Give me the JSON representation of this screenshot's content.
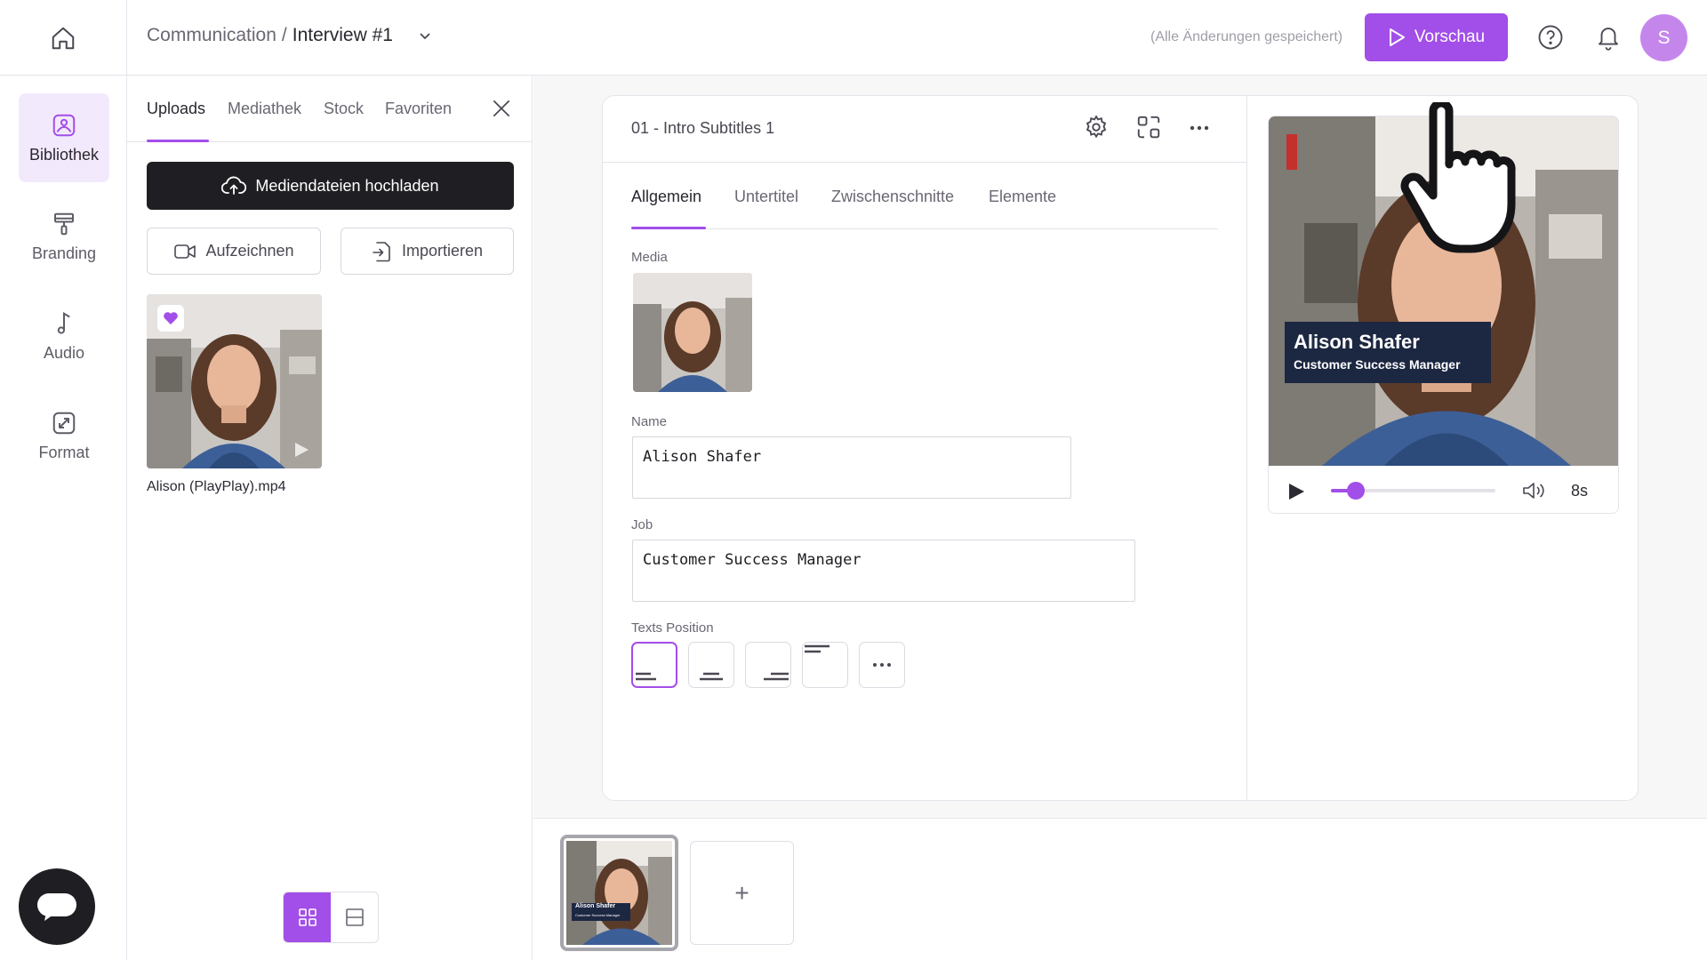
{
  "topbar": {
    "breadcrumb_parent": "Communication",
    "breadcrumb_sep": "/",
    "breadcrumb_current": "Interview #1",
    "saved_status": "(Alle Änderungen gespeichert)",
    "preview_label": "Vorschau",
    "avatar_initial": "S"
  },
  "leftnav": {
    "items": [
      {
        "label": "Bibliothek",
        "icon": "image-icon",
        "active": true
      },
      {
        "label": "Branding",
        "icon": "paint-roller-icon",
        "active": false
      },
      {
        "label": "Audio",
        "icon": "music-note-icon",
        "active": false
      },
      {
        "label": "Format",
        "icon": "resize-icon",
        "active": false
      }
    ]
  },
  "library": {
    "tabs": [
      "Uploads",
      "Mediathek",
      "Stock",
      "Favoriten"
    ],
    "active_tab": "Uploads",
    "upload_label": "Mediendateien hochladen",
    "record_label": "Aufzeichnen",
    "import_label": "Importieren",
    "media": [
      {
        "name": "Alison (PlayPlay).mp4",
        "favorite": true
      }
    ]
  },
  "editor": {
    "scene_title": "01 - Intro Subtitles 1",
    "tabs": [
      "Allgemein",
      "Untertitel",
      "Zwischenschnitte",
      "Elemente"
    ],
    "active_tab": "Allgemein",
    "media_label": "Media",
    "name_label": "Name",
    "name_value": "Alison Shafer",
    "job_label": "Job",
    "job_value": "Customer Success Manager",
    "texts_position_label": "Texts Position",
    "positions": [
      "bottom-left",
      "bottom-center",
      "bottom-right",
      "top-left",
      "more"
    ],
    "active_position": "bottom-left"
  },
  "preview": {
    "overlay_name": "Alison Shafer",
    "overlay_job": "Customer Success Manager",
    "progress_fraction": 0.15,
    "duration": "8s"
  },
  "timeline": {
    "thumb_name": "Alison Shafer",
    "thumb_job": "Customer Success Manager",
    "add_label": "+"
  },
  "colors": {
    "accent": "#a24ee8",
    "accent_light": "#f3e9fc",
    "dark_button": "#1f1f23",
    "lower_third_bg": "#1c2742"
  }
}
